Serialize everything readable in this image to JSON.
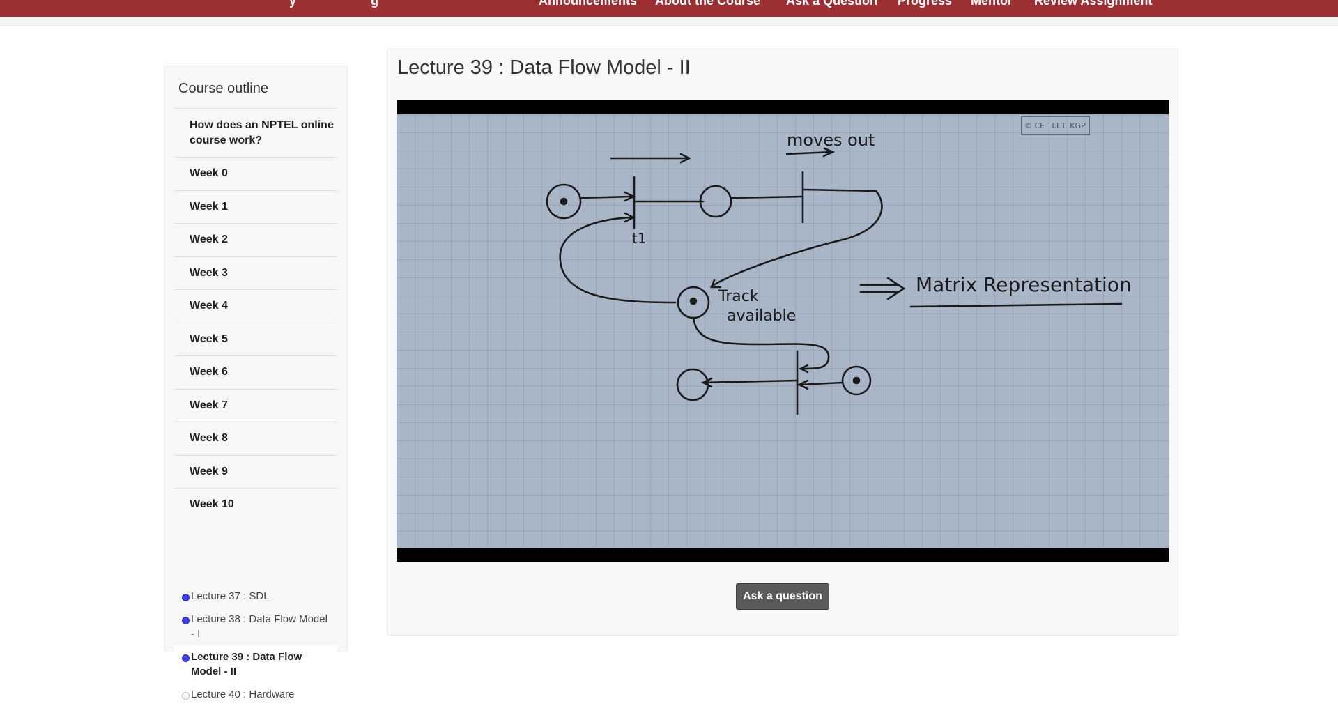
{
  "nav": {
    "left_items": [
      "y",
      "g"
    ],
    "right_items": [
      "Announcements",
      "About the Course",
      "Ask a Question",
      "Progress",
      "Mentor",
      "Review Assignment"
    ]
  },
  "sidebar": {
    "title": "Course outline",
    "items": [
      {
        "label": "How does an NPTEL online course work?"
      },
      {
        "label": "Week 0"
      },
      {
        "label": "Week 1"
      },
      {
        "label": "Week 2"
      },
      {
        "label": "Week 3"
      },
      {
        "label": "Week 4"
      },
      {
        "label": "Week 5"
      },
      {
        "label": "Week 6"
      },
      {
        "label": "Week 7"
      },
      {
        "label": "Week 8"
      },
      {
        "label": "Week 9"
      },
      {
        "label": "Week 10"
      }
    ],
    "lectures": [
      {
        "label": "Lecture 37 : SDL",
        "status": "viewed"
      },
      {
        "label": "Lecture 38 : Data Flow Model - I",
        "status": "viewed"
      },
      {
        "label": "Lecture 39 : Data Flow Model - II",
        "status": "viewed",
        "active": true
      },
      {
        "label": "Lecture 40 : Hardware",
        "status": "not-viewed"
      }
    ]
  },
  "main": {
    "title": "Lecture 39 : Data Flow Model - II",
    "video": {
      "watermark": "© CET I.I.T. KGP",
      "handwriting": [
        "moves out",
        "t1",
        "Track available",
        "Matrix Representation"
      ]
    },
    "ask_button": "Ask a question"
  },
  "colors": {
    "nav_bg": "#9b2f32",
    "progress_dot": "#3f3fe6",
    "button_bg": "#5a5a5a"
  }
}
